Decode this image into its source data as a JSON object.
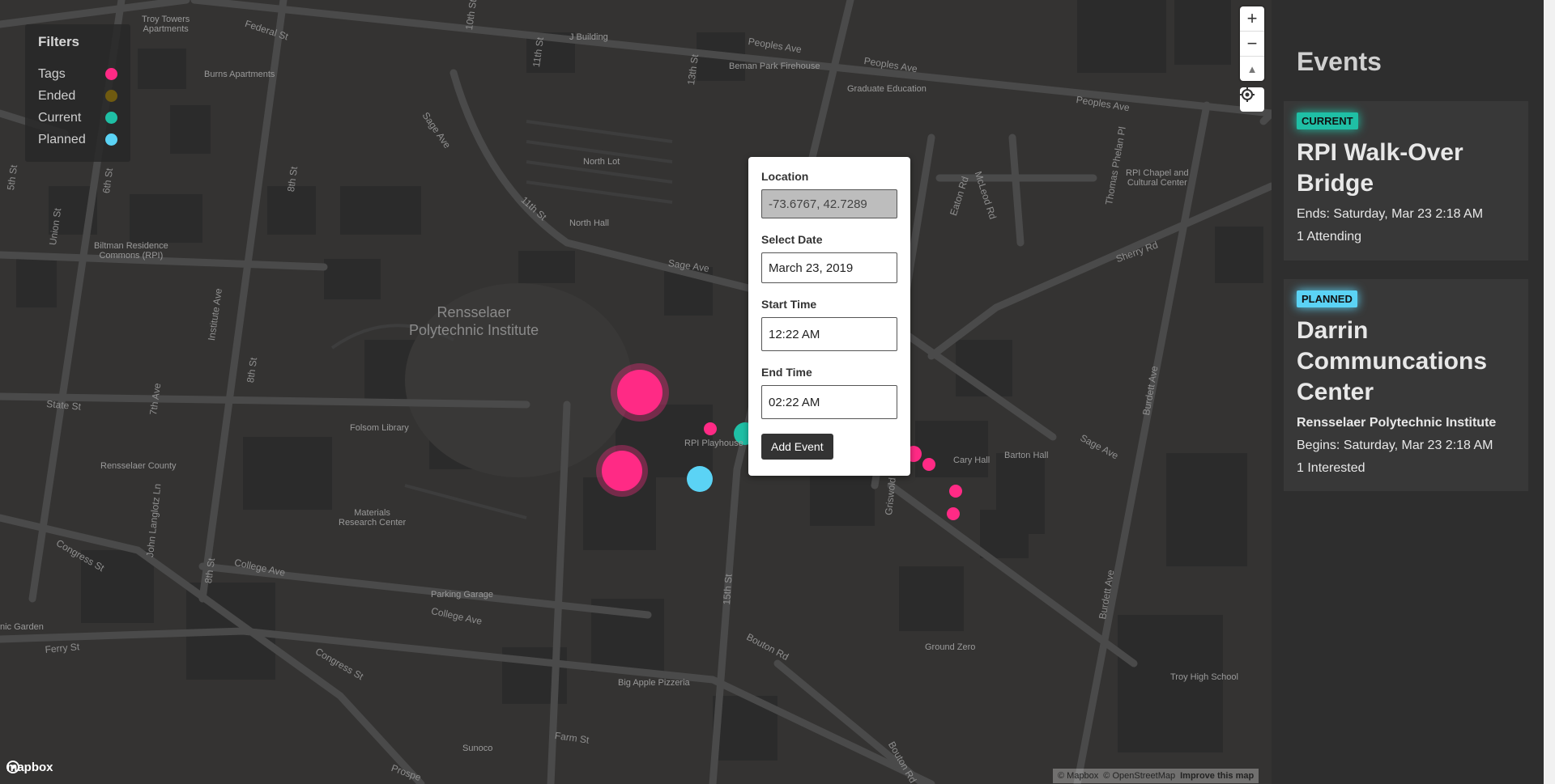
{
  "map": {
    "labels": {
      "rpi": "Rensselaer\nPolytechnic Institute",
      "troy_towers": "Troy Towers\nApartments",
      "burns": "Burns Apartments",
      "j_building": "J Building",
      "beman_firehouse": "Beman Park Firehouse",
      "graduate_education": "Graduate Education",
      "north_lot": "North Lot",
      "north_hall": "North Hall",
      "rpi_chapel": "RPI Chapel and\nCultural Center",
      "biltman": "Biltman Residence\nCommons (RPI)",
      "folsom": "Folsom Library",
      "rpi_playhouse": "RPI Playhouse",
      "cary_hall": "Cary Hall",
      "barton_hall": "Barton Hall",
      "rensselaer_county": "Rensselaer County",
      "materials": "Materials\nResearch Center",
      "parking_garage": "Parking Garage",
      "ground_zero": "Ground Zero",
      "troy_high": "Troy High School",
      "big_apple": "Big Apple Pizzeria",
      "sunoco": "Sunoco",
      "nic_garden": "nic Garden"
    },
    "streets": {
      "federal": "Federal St",
      "peoples1": "Peoples Ave",
      "peoples2": "Peoples Ave",
      "peoples3": "Peoples Ave",
      "sage1": "Sage Ave",
      "sage2": "Sage Ave",
      "sage3": "Sage Ave",
      "tenth": "10th St",
      "eleventh": "11th St",
      "eleventh2": "11th St",
      "thirteenth": "13th St",
      "eighth1": "8th St",
      "eighth2": "8th St",
      "eighth3": "8th St",
      "sixth": "6th St",
      "fifth": "5th St",
      "union": "Union St",
      "institute": "Institute Ave",
      "seventh": "7th Ave",
      "state": "State St",
      "congress1": "Congress St",
      "congress2": "Congress St",
      "college1": "College Ave",
      "college2": "College Ave",
      "ferry": "Ferry St",
      "farm": "Farm St",
      "bouton1": "Bouton Rd",
      "bouton2": "Bouton Rd",
      "fifteenth": "15th St",
      "burdett1": "Burdett Ave",
      "burdett2": "Burdett Ave",
      "eaton": "Eaton Rd",
      "mcleod": "McLeod Rd",
      "sherry": "Sherry Rd",
      "thomas_phelan": "Thomas Phelan Pl",
      "griswold": "Griswold Rd",
      "john_langlotz": "John Langlotz Ln",
      "prospect": "Prospe"
    },
    "attribution": {
      "mapbox": "© Mapbox",
      "osm": "© OpenStreetMap",
      "improve": "Improve this map"
    },
    "logo": "mapbox"
  },
  "filters": {
    "title": "Filters",
    "items": [
      {
        "label": "Tags",
        "color": "#ff2a85"
      },
      {
        "label": "Ended",
        "color": "#6f5a10"
      },
      {
        "label": "Current",
        "color": "#1fbfa5"
      },
      {
        "label": "Planned",
        "color": "#5bd3f5"
      }
    ]
  },
  "controls": {
    "zoom_in": "+",
    "zoom_out": "−",
    "compass": "▲"
  },
  "popup": {
    "location_label": "Location",
    "location_value": "-73.6767, 42.7289",
    "date_label": "Select Date",
    "date_value": "March 23, 2019",
    "start_label": "Start Time",
    "start_value": "12:22 AM",
    "end_label": "End Time",
    "end_value": "02:22 AM",
    "submit_label": "Add Event"
  },
  "sidebar": {
    "title": "Events",
    "events": [
      {
        "status": "CURRENT",
        "name": "RPI Walk-Over Bridge",
        "time": "Ends: Saturday, Mar 23 2:18 AM",
        "count": "1 Attending"
      },
      {
        "status": "PLANNED",
        "name": "Darrin Communcations Center",
        "place": "Rensselaer Polytechnic Institute",
        "time": "Begins: Saturday, Mar 23 2:18 AM",
        "count": "1 Interested"
      }
    ]
  }
}
